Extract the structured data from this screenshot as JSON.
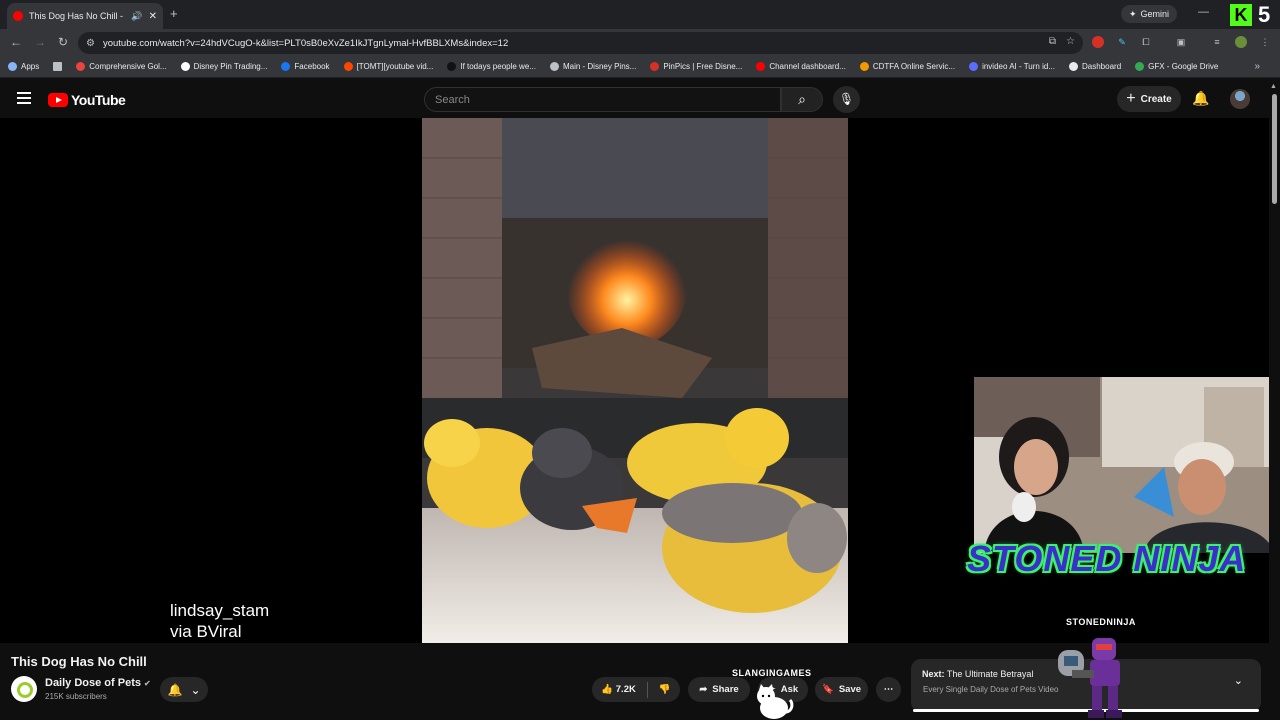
{
  "browser": {
    "tab_title": "This Dog Has No Chill - You",
    "speaker_icon": "speaker-icon",
    "new_tab": "+",
    "gemini_label": "Gemini",
    "profile_badge": "5",
    "url": "youtube.com/watch?v=24hdVCugO-k&list=PLT0sB0eXvZe1IkJTgnLymal-HvfBBLXMs&index=12"
  },
  "bookmarks": [
    {
      "label": "Apps",
      "color": "#8ab4f8"
    },
    {
      "label": "",
      "color": "#bdc1c6"
    },
    {
      "label": "Comprehensive Gol...",
      "color": "#e8453c"
    },
    {
      "label": "Disney Pin Trading...",
      "color": "#ffffff"
    },
    {
      "label": "Facebook",
      "color": "#1877f2"
    },
    {
      "label": "[TOMT][youtube vid...",
      "color": "#ff4500"
    },
    {
      "label": "If todays people we...",
      "color": "#111111"
    },
    {
      "label": "Main - Disney Pins...",
      "color": "#bdc1c6"
    },
    {
      "label": "PinPics | Free Disne...",
      "color": "#d93025"
    },
    {
      "label": "Channel dashboard...",
      "color": "#ff0000"
    },
    {
      "label": "CDTFA Online Servic...",
      "color": "#f29900"
    },
    {
      "label": "invideo AI - Turn id...",
      "color": "#5b6cff"
    },
    {
      "label": "Dashboard",
      "color": "#e8eaed"
    },
    {
      "label": "GFX - Google Drive",
      "color": "#34a853"
    }
  ],
  "youtube": {
    "logo_text": "YouTube",
    "search_placeholder": "Search",
    "create_label": "Create",
    "watermark_line1": "lindsay_stam",
    "watermark_line2": "via BViral",
    "overlay_title": "STONED NINJA",
    "overlay_handle": "STONEDNINJA",
    "overlay_slang": "SLANGINGAMES",
    "video_title": "This Dog Has No Chill",
    "channel_name": "Daily Dose of Pets",
    "subscribers": "215K subscribers",
    "likes": "7.2K",
    "share_label": "Share",
    "ask_label": "Ask",
    "save_label": "Save",
    "next_prefix": "Next:",
    "next_title": "The Ultimate Betrayal",
    "next_playlist": "Every Single Daily Dose of Pets Video"
  }
}
